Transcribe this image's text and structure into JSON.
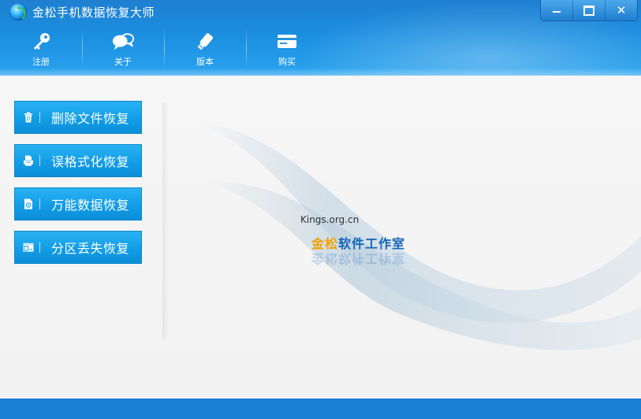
{
  "window": {
    "title": "金松手机数据恢复大师",
    "controls": [
      "minimize",
      "maximize",
      "close"
    ]
  },
  "toolbar": [
    {
      "label": "注册",
      "icon": "key-icon"
    },
    {
      "label": "关于",
      "icon": "chat-bubbles-icon"
    },
    {
      "label": "版本",
      "icon": "usb-drive-icon"
    },
    {
      "label": "购买",
      "icon": "credit-card-icon"
    }
  ],
  "menu": [
    {
      "label": "删除文件恢复",
      "icon": "trash-icon"
    },
    {
      "label": "误格式化恢复",
      "icon": "printer-icon"
    },
    {
      "label": "万能数据恢复",
      "icon": "document-icon"
    },
    {
      "label": "分区丢失恢复",
      "icon": "partition-icon"
    }
  ],
  "brand": {
    "url": "Kings.org.cn",
    "name_highlight": "金松",
    "name_rest": "软件工作室"
  },
  "colors": {
    "accent": "#1b8ee0",
    "button": "#119de6",
    "brand_blue": "#1565b8",
    "brand_orange": "#f0a000"
  }
}
